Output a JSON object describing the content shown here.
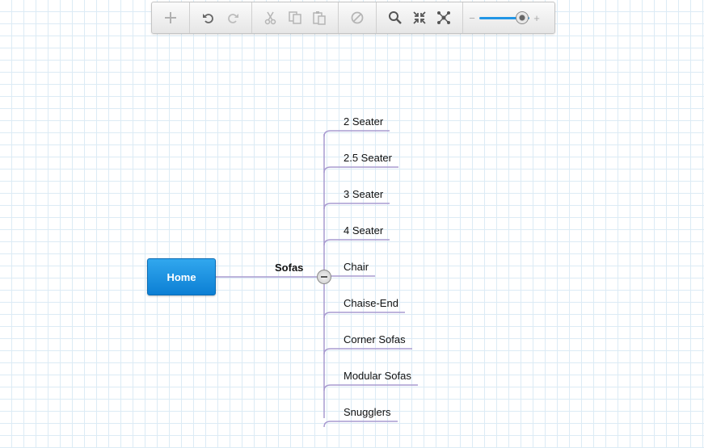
{
  "toolbar": {
    "icons": [
      "plus-icon",
      "undo-icon",
      "redo-icon",
      "cut-icon",
      "copy-icon",
      "paste-icon",
      "disable-icon",
      "search-icon",
      "collapse-arrows-icon",
      "expand-network-icon"
    ],
    "zoom": {
      "minus_label": "−",
      "plus_label": "+",
      "level": 0.85
    }
  },
  "colors": {
    "grid": "#dcebf5",
    "accent": "#0c7fd4",
    "connector": "#a99bd0",
    "slider": "#2196e6"
  },
  "mindmap": {
    "root": {
      "label": "Home"
    },
    "branch": {
      "label": "Sofas"
    },
    "children": [
      {
        "label": "2 Seater"
      },
      {
        "label": "2.5 Seater"
      },
      {
        "label": "3 Seater"
      },
      {
        "label": "4 Seater"
      },
      {
        "label": "Chair"
      },
      {
        "label": "Chaise-End"
      },
      {
        "label": "Corner Sofas"
      },
      {
        "label": "Modular Sofas"
      },
      {
        "label": "Snugglers"
      }
    ]
  }
}
